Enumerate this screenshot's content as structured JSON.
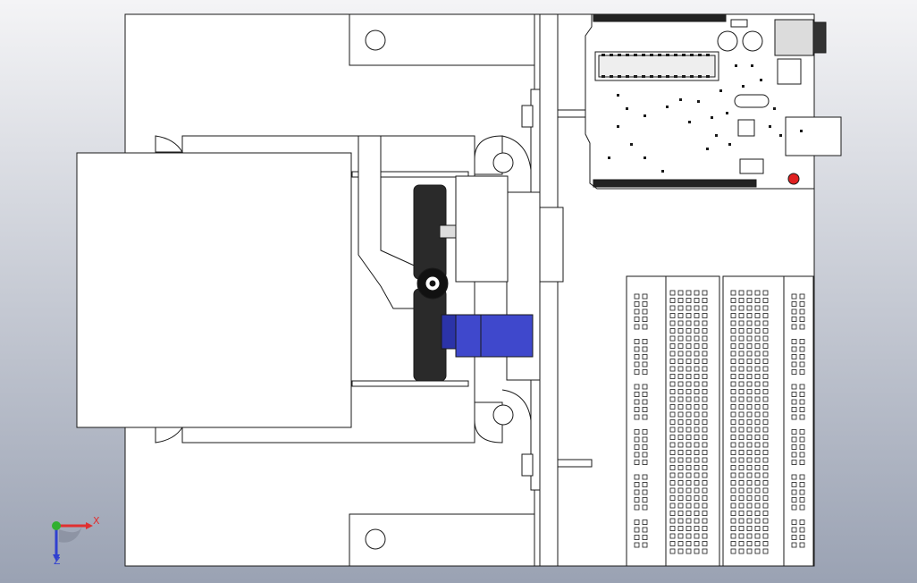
{
  "viewport": {
    "background_top": "#f4f4f6",
    "background_bottom": "#9aa2b3"
  },
  "colors": {
    "outline": "#1a1a1a",
    "part_fill": "#ffffff",
    "servo_blue": "#3f48cc",
    "servo_blue_dark": "#2b33a8",
    "wheel_dark": "#2a2a2a",
    "button_red": "#e02020",
    "axis_x": "#e03030",
    "axis_y": "#30b030",
    "axis_z": "#3040d0"
  },
  "triad": {
    "x_label": "X",
    "z_label": "Z",
    "icons": [
      "x-axis-arrow-icon",
      "y-axis-icon",
      "z-axis-arrow-icon"
    ]
  }
}
